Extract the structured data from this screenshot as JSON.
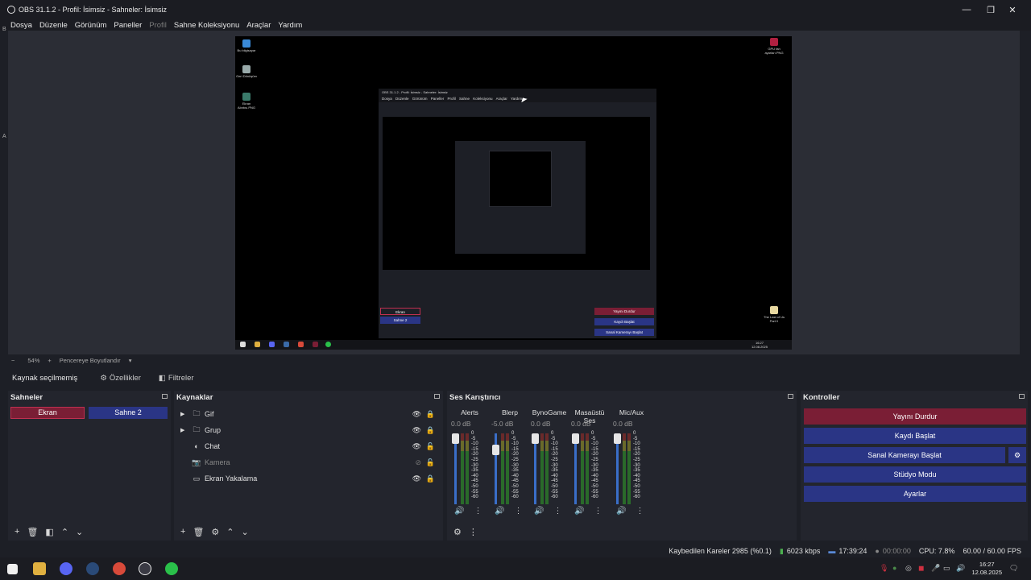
{
  "window": {
    "title": "OBS 31.1.2 - Profil: İsimsiz - Sahneler: İsimsiz",
    "minimize": "—",
    "maximize": "❐",
    "close": "✕"
  },
  "menu": [
    "Dosya",
    "Düzenle",
    "Görünüm",
    "Paneller",
    "Profil",
    "Sahne Koleksiyonu",
    "Araçlar",
    "Yardım"
  ],
  "preview": {
    "zoom_out": "−",
    "zoom": "54%",
    "zoom_in": "+",
    "fit_label": "Pencereye Boyutlandır",
    "fit_caret": "▾",
    "desktop_icons": [
      "Bu bilgisayar",
      "Geri Dönüşüm",
      "Ekran Alıntısı.PNG",
      "GPU fan ayarları.PNG",
      "The Last of Us Part II"
    ],
    "nested_title": "OBS 31.1.2 - Profil: İsimsiz - Sahneler: İsimsiz",
    "nested_menu": "Dosya Düzenle Görünüm Paneller Profil Sahne Koleksiyonu Araçlar Yardım",
    "nested_clock": "16:27",
    "nested_date": "12.08.2025"
  },
  "source_toolbar": {
    "no_source": "Kaynak seçilmemiş",
    "properties": "Özellikler",
    "filters": "Filtreler"
  },
  "scenes": {
    "title": "Sahneler",
    "items": [
      "Ekran",
      "Sahne 2"
    ]
  },
  "sources": {
    "title": "Kaynaklar",
    "items": [
      {
        "name": "Gif",
        "icon": "folder-icon",
        "group": true,
        "visible": true
      },
      {
        "name": "Grup",
        "icon": "folder-icon",
        "group": true,
        "visible": true
      },
      {
        "name": "Chat",
        "icon": "browser-icon",
        "group": false,
        "visible": true
      },
      {
        "name": "Kamera",
        "icon": "camera-icon",
        "group": false,
        "visible": false
      },
      {
        "name": "Ekran Yakalama",
        "icon": "monitor-icon",
        "group": false,
        "visible": true
      }
    ]
  },
  "mixer": {
    "title": "Ses Karıştırıcı",
    "scale": [
      "0",
      "-5",
      "-10",
      "-15",
      "-20",
      "-25",
      "-30",
      "-35",
      "-40",
      "-45",
      "-50",
      "-55",
      "-60"
    ],
    "channels": [
      {
        "name": "Alerts",
        "db": "0.0 dB",
        "level": 1.0
      },
      {
        "name": "Blerp",
        "db": "-5.0 dB",
        "level": 0.82
      },
      {
        "name": "BynoGame",
        "db": "0.0 dB",
        "level": 1.0
      },
      {
        "name": "Masaüstü Ses",
        "db": "0.0 dB",
        "level": 1.0
      },
      {
        "name": "Mic/Aux",
        "db": "0.0 dB",
        "level": 1.0
      }
    ]
  },
  "controls": {
    "title": "Kontroller",
    "stop_stream": "Yayını Durdur",
    "start_record": "Kaydı Başlat",
    "start_virtualcam": "Sanal Kamerayı Başlat",
    "studio_mode": "Stüdyo Modu",
    "settings": "Ayarlar"
  },
  "status": {
    "dropped": "Kaybedilen Kareler 2985 (%0.1)",
    "bitrate": "6023 kbps",
    "stream_time": "17:39:24",
    "rec_time": "00:00:00",
    "cpu": "CPU: 7.8%",
    "fps": "60.00 / 60.00 FPS"
  },
  "taskbar": {
    "time": "16:27",
    "date": "12.08.2025"
  },
  "colors": {
    "accent_red": "#7a1e35",
    "accent_blue": "#2a3585"
  }
}
